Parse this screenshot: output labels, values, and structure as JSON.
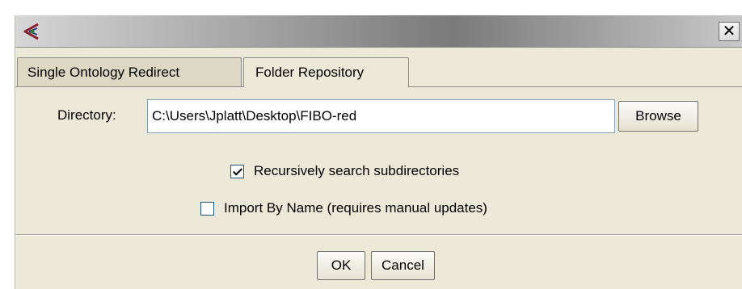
{
  "window": {
    "icon": "protege-app-icon",
    "close_label": "✕"
  },
  "tabs": [
    {
      "label": "Single Ontology Redirect",
      "active": false
    },
    {
      "label": "Folder Repository",
      "active": true
    }
  ],
  "form": {
    "directory_label": "Directory:",
    "directory_value": "C:\\Users\\Jplatt\\Desktop\\FIBO-red",
    "browse_label": "Browse",
    "recursive_label": "Recursively search subdirectories",
    "recursive_checked": true,
    "import_by_name_label": "Import By Name (requires manual updates)",
    "import_by_name_checked": false
  },
  "footer": {
    "ok_label": "OK",
    "cancel_label": "Cancel"
  }
}
